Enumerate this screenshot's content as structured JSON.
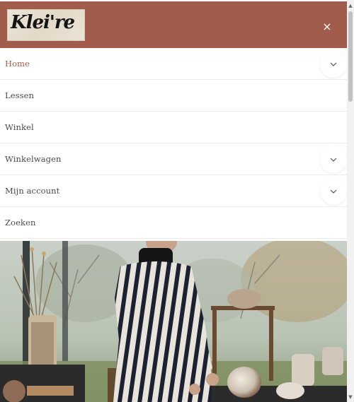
{
  "brand": {
    "logo_text": "Klei're",
    "header_color": "#a25c4c"
  },
  "header": {
    "close_label": "×"
  },
  "menu": {
    "items": [
      {
        "label": "Home",
        "active": true,
        "has_submenu": true
      },
      {
        "label": "Lessen",
        "active": false,
        "has_submenu": false
      },
      {
        "label": "Winkel",
        "active": false,
        "has_submenu": false
      },
      {
        "label": "Winkelwagen",
        "active": false,
        "has_submenu": true
      },
      {
        "label": "Mijn account",
        "active": false,
        "has_submenu": true
      },
      {
        "label": "Zoeken",
        "active": false,
        "has_submenu": false
      }
    ],
    "toggle_icon": "chevron-down-icon"
  },
  "hero": {
    "image": "photo of a woman in a striped dress standing among ceramic pottery in a greenhouse"
  },
  "scrollbar": {
    "up_glyph": "▲",
    "down_glyph": "▼"
  }
}
